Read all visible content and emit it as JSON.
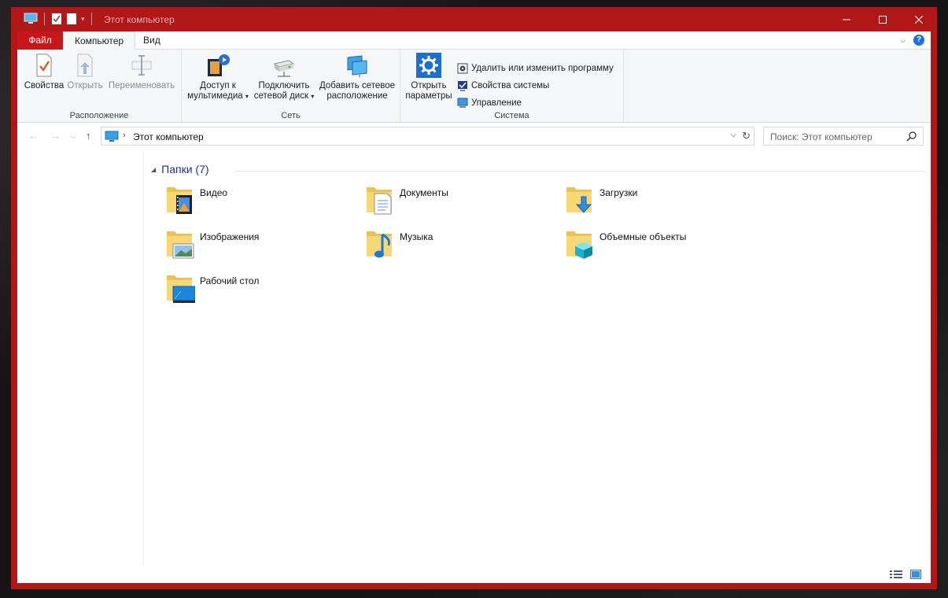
{
  "window": {
    "title": "Этот компьютер",
    "accent": "#b11717"
  },
  "tabs": [
    {
      "label": "Файл"
    },
    {
      "label": "Компьютер"
    },
    {
      "label": "Вид"
    }
  ],
  "ribbon": {
    "groups": {
      "location": {
        "label": "Расположение",
        "buttons": [
          {
            "label": "Свойства",
            "icon": "properties-icon"
          },
          {
            "label": "Открыть",
            "icon": "open-icon"
          },
          {
            "label": "Переименовать",
            "icon": "rename-icon"
          }
        ]
      },
      "network": {
        "label": "Сеть",
        "buttons": [
          {
            "line1": "Доступ к",
            "line2": "мультимедиа",
            "icon": "media-access-icon"
          },
          {
            "line1": "Подключить",
            "line2": "сетевой диск",
            "icon": "network-drive-icon"
          },
          {
            "line1": "Добавить сетевое",
            "line2": "расположение",
            "icon": "add-network-location-icon"
          }
        ]
      },
      "system": {
        "label": "Система",
        "open_settings": {
          "line1": "Открыть",
          "line2": "параметры"
        },
        "small_buttons": [
          {
            "label": "Удалить или изменить программу",
            "icon": "uninstall-program-icon"
          },
          {
            "label": "Свойства системы",
            "icon": "system-properties-icon"
          },
          {
            "label": "Управление",
            "icon": "manage-icon"
          }
        ]
      }
    }
  },
  "addressbar": {
    "path": "Этот компьютер",
    "search_placeholder": "Поиск: Этот компьютер"
  },
  "folders_group": {
    "title": "Папки (7)",
    "items": [
      {
        "label": "Видео",
        "overlay": "video"
      },
      {
        "label": "Документы",
        "overlay": "documents"
      },
      {
        "label": "Загрузки",
        "overlay": "downloads"
      },
      {
        "label": "Изображения",
        "overlay": "pictures"
      },
      {
        "label": "Музыка",
        "overlay": "music"
      },
      {
        "label": "Объемные объекты",
        "overlay": "3d"
      },
      {
        "label": "Рабочий стол",
        "overlay": "desktop"
      }
    ]
  }
}
